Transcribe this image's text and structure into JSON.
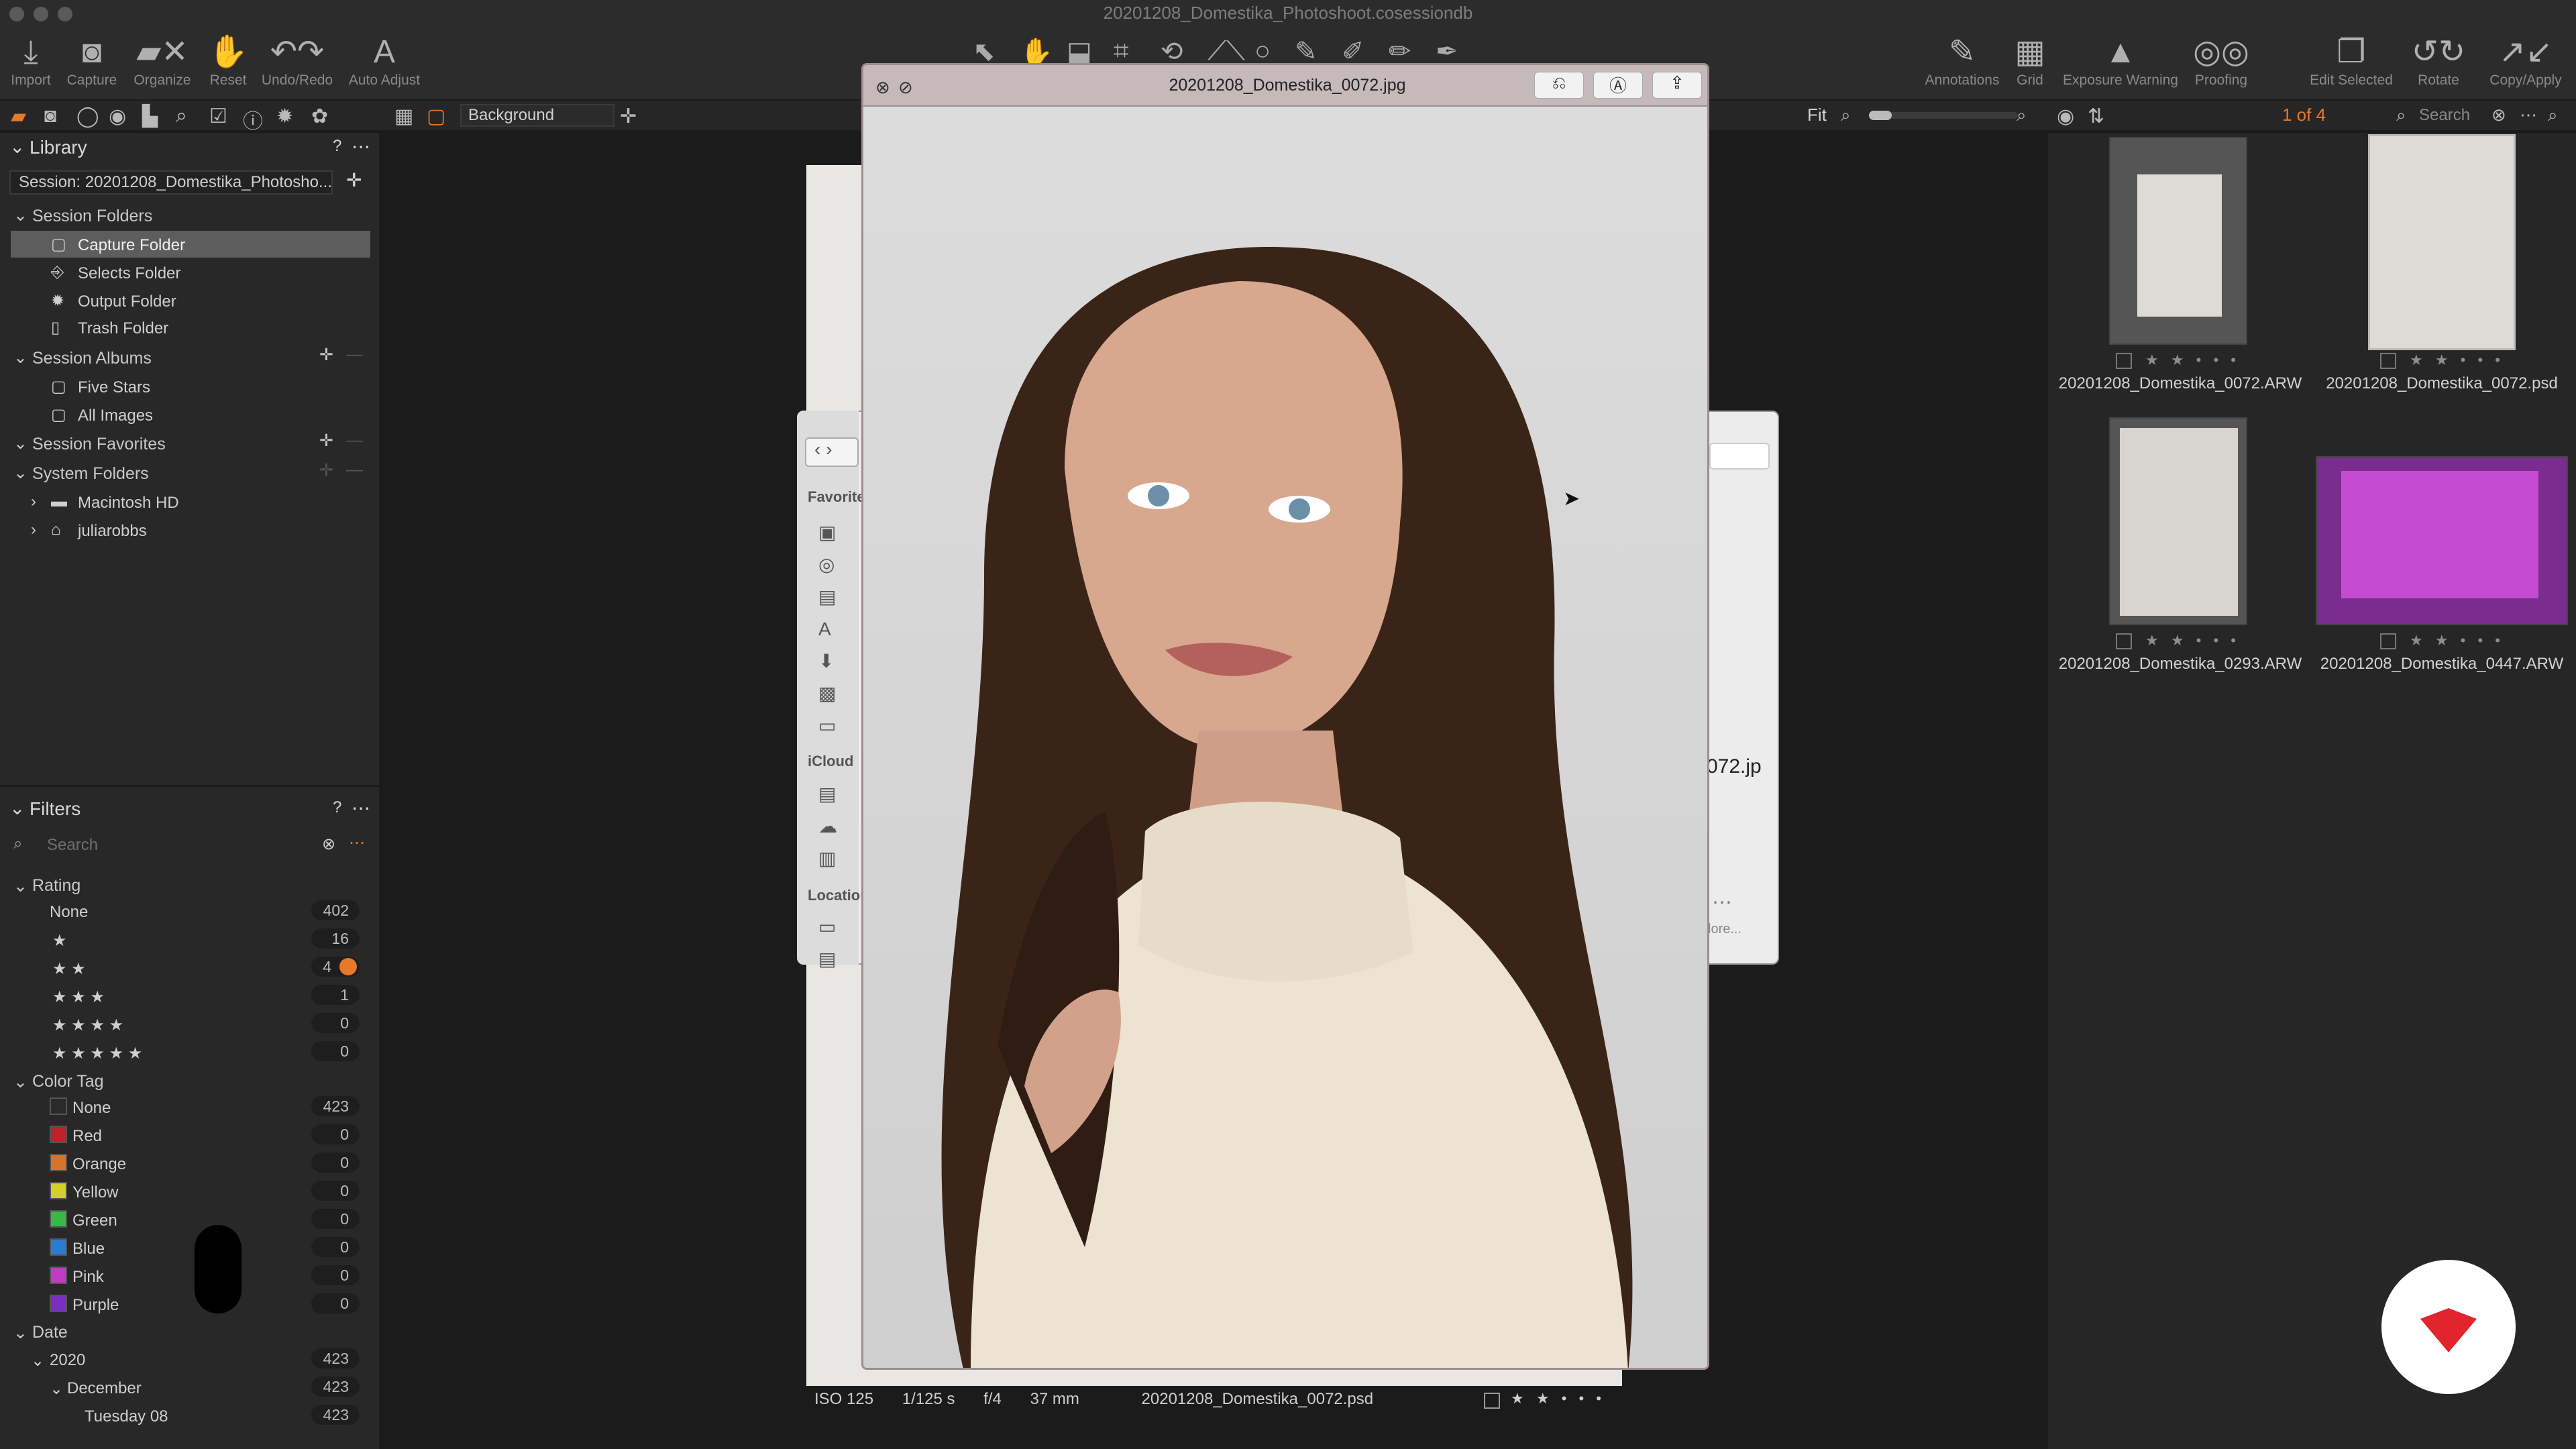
{
  "window": {
    "title": "20201208_Domestika_Photoshoot.cosessiondb"
  },
  "toolbar": {
    "left": [
      {
        "label": "Import",
        "icon": "import-icon"
      },
      {
        "label": "Capture",
        "icon": "camera-icon"
      },
      {
        "label": "Organize",
        "icon": "organize-icon"
      },
      {
        "label": "Reset",
        "icon": "reset-icon"
      },
      {
        "label": "Undo/Redo",
        "icon": "undo-redo-icon"
      },
      {
        "label": "Auto Adjust",
        "icon": "auto-adjust-icon"
      }
    ],
    "right": [
      {
        "label": "Annotations",
        "icon": "annotations-icon"
      },
      {
        "label": "Grid",
        "icon": "grid-icon"
      },
      {
        "label": "Exposure Warning",
        "icon": "warning-icon"
      },
      {
        "label": "Proofing",
        "icon": "proofing-icon"
      },
      {
        "label": "Edit Selected",
        "icon": "edit-selected-icon"
      },
      {
        "label": "Rotate",
        "icon": "rotate-icon"
      },
      {
        "label": "Copy/Apply",
        "icon": "copy-apply-icon"
      }
    ]
  },
  "strip": {
    "background_select": "Background",
    "zoom_label": "Fit",
    "counter": "1 of 4",
    "search_placeholder": "Search"
  },
  "library": {
    "title": "Library",
    "session_select": "Session: 20201208_Domestika_Photosho...",
    "session_folders_title": "Session Folders",
    "session_folders": [
      "Capture Folder",
      "Selects Folder",
      "Output Folder",
      "Trash Folder"
    ],
    "session_albums_title": "Session Albums",
    "session_albums": [
      "Five Stars",
      "All Images"
    ],
    "session_favorites_title": "Session Favorites",
    "system_folders_title": "System Folders",
    "system_folders": [
      "Macintosh HD",
      "juliarobbs"
    ]
  },
  "filters": {
    "title": "Filters",
    "search_placeholder": "Search",
    "rating_title": "Rating",
    "ratings": [
      {
        "label": "None",
        "count": "402"
      },
      {
        "label": "★",
        "count": "16"
      },
      {
        "label": "★ ★",
        "count": "4"
      },
      {
        "label": "★ ★ ★",
        "count": "1"
      },
      {
        "label": "★ ★ ★ ★",
        "count": "0"
      },
      {
        "label": "★ ★ ★ ★ ★",
        "count": "0"
      }
    ],
    "color_tag_title": "Color Tag",
    "color_tags": [
      {
        "label": "None",
        "count": "423",
        "color": "#2a2a2a"
      },
      {
        "label": "Red",
        "count": "0",
        "color": "#c0202a"
      },
      {
        "label": "Orange",
        "count": "0",
        "color": "#d5742a"
      },
      {
        "label": "Yellow",
        "count": "0",
        "color": "#d4cf2a"
      },
      {
        "label": "Green",
        "count": "0",
        "color": "#39b84a"
      },
      {
        "label": "Blue",
        "count": "0",
        "color": "#2b7bd1"
      },
      {
        "label": "Pink",
        "count": "0",
        "color": "#c13bc4"
      },
      {
        "label": "Purple",
        "count": "0",
        "color": "#7a2fc0"
      }
    ],
    "date_title": "Date",
    "dates": [
      {
        "label": "2020",
        "count": "423"
      },
      {
        "label": "December",
        "count": "423"
      },
      {
        "label": "Tuesday 08",
        "count": "423"
      }
    ]
  },
  "viewer": {
    "title": "20201208_Domestika_0072.jpg"
  },
  "finder": {
    "favorites_title": "Favorite",
    "icloud_title": "iCloud",
    "locations_title": "Location",
    "filename_fragment": "072.jp",
    "more_label": "lore..."
  },
  "status": {
    "iso": "ISO 125",
    "shutter": "1/125 s",
    "aperture": "f/4",
    "focal": "37 mm",
    "filename": "20201208_Domestika_0072.psd"
  },
  "browser": {
    "items": [
      {
        "name": "20201208_Domestika_0072.ARW",
        "stars": "★ ★ • • •"
      },
      {
        "name": "20201208_Domestika_0072.psd",
        "stars": "★ ★ • • •"
      },
      {
        "name": "20201208_Domestika_0293.ARW",
        "stars": "★ ★ • • •"
      },
      {
        "name": "20201208_Domestika_0447.ARW",
        "stars": "★ ★ • • •"
      }
    ]
  },
  "colors": {
    "accent": "#e8782a",
    "selected_row": "#5d5d5d",
    "logo_red": "#e2242f"
  }
}
